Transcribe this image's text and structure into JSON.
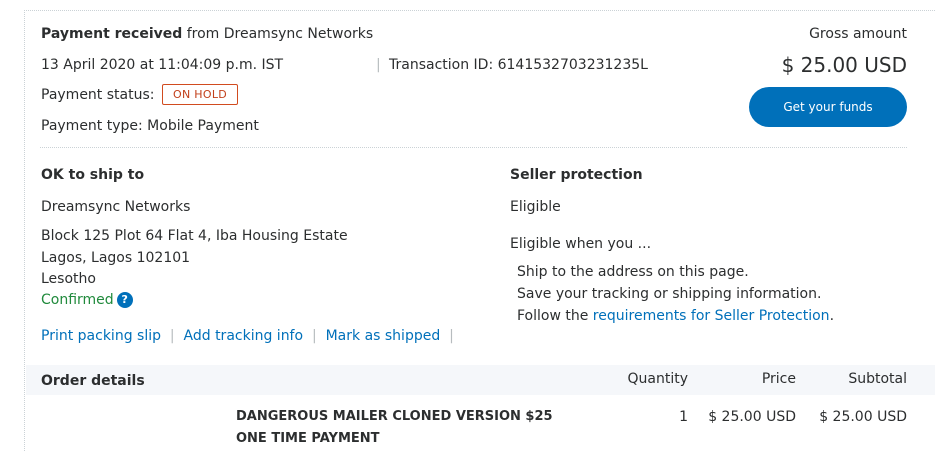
{
  "summary": {
    "payment_received_label": "Payment received",
    "from_text": "from Dreamsync Networks",
    "datetime": "13 April 2020 at 11:04:09 p.m. IST",
    "transaction_label": "Transaction ID: 6141532703231235L",
    "status_label": "Payment status:",
    "status_badge": "ON HOLD",
    "payment_type": "Payment type: Mobile Payment",
    "gross_label": "Gross amount",
    "gross_value": "$ 25.00 USD",
    "funds_button": "Get your funds"
  },
  "shipping": {
    "heading": "OK to ship to",
    "name": "Dreamsync Networks",
    "address_line1": "Block 125 Plot 64 Flat 4, Iba Housing Estate",
    "address_line2": "Lagos, Lagos 102101",
    "address_line3": "Lesotho",
    "confirmed": "Confirmed",
    "help_glyph": "?",
    "actions": {
      "print": "Print packing slip",
      "tracking": "Add tracking info",
      "shipped": "Mark as shipped"
    }
  },
  "seller_protection": {
    "heading": "Seller protection",
    "status": "Eligible",
    "when_text": "Eligible when you ...",
    "item1": "Ship to the address on this page.",
    "item2": "Save your tracking or shipping information.",
    "item3_prefix": "Follow the",
    "item3_link": "requirements for Seller Protection",
    "item3_suffix": "."
  },
  "order": {
    "heading": "Order details",
    "columns": {
      "quantity": "Quantity",
      "price": "Price",
      "subtotal": "Subtotal"
    },
    "item": {
      "name_line1": "DANGEROUS MAILER CLONED VERSION $25",
      "name_line2": "ONE TIME PAYMENT",
      "quantity": "1",
      "price": "$ 25.00 USD",
      "subtotal": "$ 25.00 USD"
    }
  },
  "colors": {
    "accent": "#0070ba",
    "status_on_hold": "#c2401b",
    "confirmed": "#208a3c"
  },
  "icons": [
    "help-icon"
  ]
}
